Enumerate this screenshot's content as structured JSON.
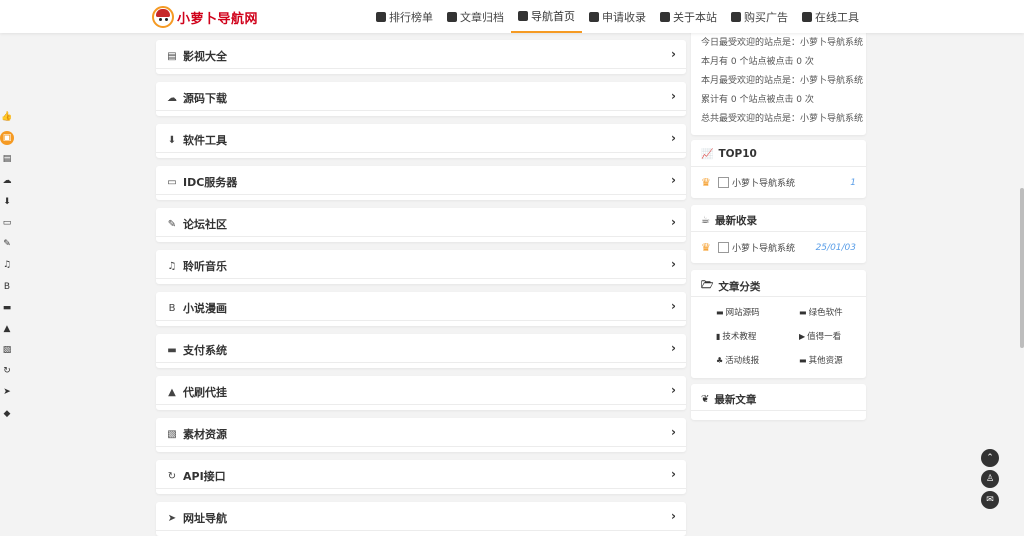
{
  "brand": {
    "name": "小萝卜导航网"
  },
  "nav": [
    {
      "label": "排行榜单",
      "icon": "chart-icon"
    },
    {
      "label": "文章归档",
      "icon": "archive-icon"
    },
    {
      "label": "导航首页",
      "icon": "home-icon",
      "active": true
    },
    {
      "label": "申请收录",
      "icon": "plus-icon"
    },
    {
      "label": "关于本站",
      "icon": "info-icon"
    },
    {
      "label": "购买广告",
      "icon": "info-icon"
    },
    {
      "label": "在线工具",
      "icon": "info-icon"
    }
  ],
  "rail": [
    {
      "icon": "thumbs-up-icon",
      "glyph": "👍"
    },
    {
      "icon": "book-icon",
      "glyph": "▣",
      "active": true
    },
    {
      "icon": "film-icon",
      "glyph": "▤"
    },
    {
      "icon": "cloud-download-icon",
      "glyph": "☁"
    },
    {
      "icon": "download-icon",
      "glyph": "⬇"
    },
    {
      "icon": "monitor-icon",
      "glyph": "▭"
    },
    {
      "icon": "edit-icon",
      "glyph": "✎"
    },
    {
      "icon": "music-icon",
      "glyph": "♫"
    },
    {
      "icon": "novel-icon",
      "glyph": "B"
    },
    {
      "icon": "payment-icon",
      "glyph": "▬"
    },
    {
      "icon": "bag-icon",
      "glyph": "▲"
    },
    {
      "icon": "image-icon",
      "glyph": "▧"
    },
    {
      "icon": "refresh-icon",
      "glyph": "↻"
    },
    {
      "icon": "send-icon",
      "glyph": "➤"
    },
    {
      "icon": "leaf-icon",
      "glyph": "◆"
    }
  ],
  "categories": [
    {
      "label": "影视大全",
      "icon": "film-icon",
      "glyph": "▤"
    },
    {
      "label": "源码下载",
      "icon": "cloud-download-icon",
      "glyph": "☁"
    },
    {
      "label": "软件工具",
      "icon": "download-icon",
      "glyph": "⬇"
    },
    {
      "label": "IDC服务器",
      "icon": "monitor-icon",
      "glyph": "▭"
    },
    {
      "label": "论坛社区",
      "icon": "edit-icon",
      "glyph": "✎"
    },
    {
      "label": "聆听音乐",
      "icon": "music-icon",
      "glyph": "♫"
    },
    {
      "label": "小说漫画",
      "icon": "novel-icon",
      "glyph": "B"
    },
    {
      "label": "支付系统",
      "icon": "payment-icon",
      "glyph": "▬"
    },
    {
      "label": "代刷代挂",
      "icon": "bag-icon",
      "glyph": "▲"
    },
    {
      "label": "素材资源",
      "icon": "image-icon",
      "glyph": "▧"
    },
    {
      "label": "API接口",
      "icon": "refresh-icon",
      "glyph": "↻"
    },
    {
      "label": "网址导航",
      "icon": "send-icon",
      "glyph": "➤"
    }
  ],
  "arrow_glyph": "›",
  "stats": {
    "lines": [
      "今日最受欢迎的站点是：小萝卜导航系统",
      "本月有 0 个站点被点击 0 次",
      "本月最受欢迎的站点是：小萝卜导航系统",
      "累计有 0 个站点被点击 0 次",
      "总共最受欢迎的站点是：小萝卜导航系统"
    ]
  },
  "top10": {
    "title": "TOP10",
    "items": [
      {
        "name": "小萝卜导航系统",
        "value": "1"
      }
    ]
  },
  "latest": {
    "title": "最新收录",
    "items": [
      {
        "name": "小萝卜导航系统",
        "date": "25/01/03"
      }
    ]
  },
  "article_categories": {
    "title": "文章分类",
    "items": [
      {
        "label": "网站源码",
        "icon": "folder-icon",
        "glyph": "▬"
      },
      {
        "label": "绿色软件",
        "icon": "folder-icon",
        "glyph": "▬"
      },
      {
        "label": "技术教程",
        "icon": "book-icon",
        "glyph": "▮"
      },
      {
        "label": "值得一看",
        "icon": "video-icon",
        "glyph": "▶"
      },
      {
        "label": "活动线报",
        "icon": "users-icon",
        "glyph": "♣"
      },
      {
        "label": "其他资源",
        "icon": "payment-icon",
        "glyph": "▬"
      }
    ]
  },
  "latest_articles": {
    "title": "最新文章"
  },
  "fabs": [
    {
      "icon": "arrow-up-icon",
      "glyph": "⌃"
    },
    {
      "icon": "qq-icon",
      "glyph": "♙"
    },
    {
      "icon": "mail-icon",
      "glyph": "✉"
    }
  ]
}
